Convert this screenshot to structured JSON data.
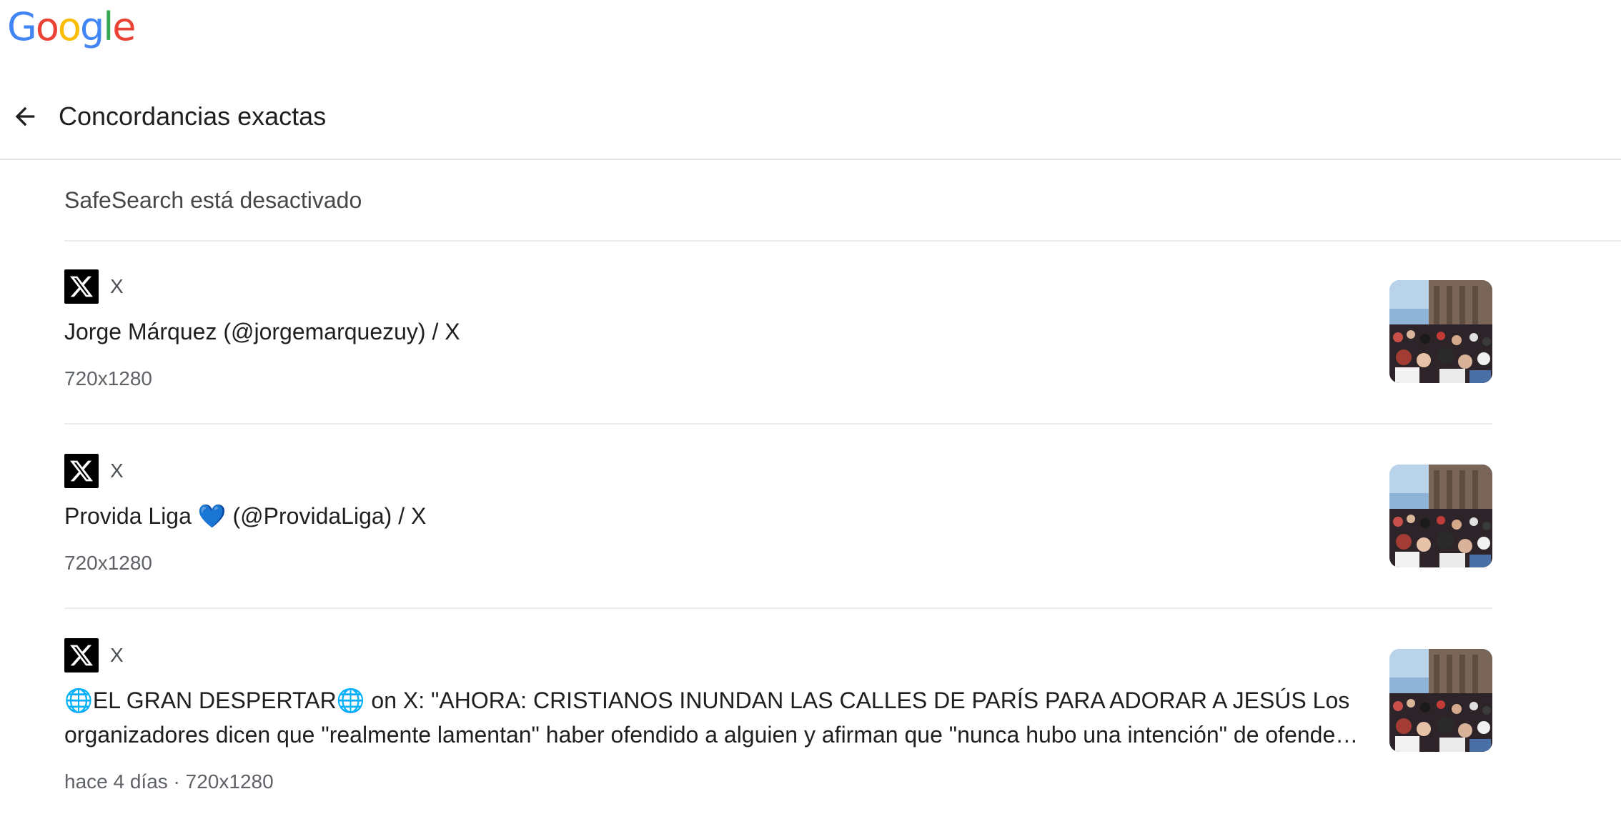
{
  "logo": {
    "letters": [
      "G",
      "o",
      "o",
      "g",
      "l",
      "e"
    ],
    "colors": [
      "#4285F4",
      "#EA4335",
      "#FBBC05",
      "#4285F4",
      "#34A853",
      "#EA4335"
    ]
  },
  "header": {
    "back_icon": "arrow-left-icon",
    "title": "Concordancias exactas"
  },
  "safesearch": {
    "label": "SafeSearch está desactivado"
  },
  "results": [
    {
      "source_icon": "x-logo-icon",
      "source": "X",
      "title": "Jorge Márquez (@jorgemarquezuy) / X",
      "meta": "720x1280"
    },
    {
      "source_icon": "x-logo-icon",
      "source": "X",
      "title": "Provida Liga 💙 (@ProvidaLiga) / X",
      "meta": "720x1280"
    },
    {
      "source_icon": "x-logo-icon",
      "source": "X",
      "title": "🌐EL GRAN DESPERTAR🌐 on X: \"AHORA: CRISTIANOS INUNDAN LAS CALLES DE PARÍS PARA ADORAR A JESÚS Los organizadores dicen que \"realmente lamentan\" haber ofendido a alguien y afirman que \"nunca hubo una intención\" de ofender a nadie\"",
      "meta": "hace 4 días · 720x1280"
    }
  ],
  "colors": {
    "title_text": "#1f1f1f",
    "meta_text": "#5f6368",
    "divider": "#ececec"
  }
}
